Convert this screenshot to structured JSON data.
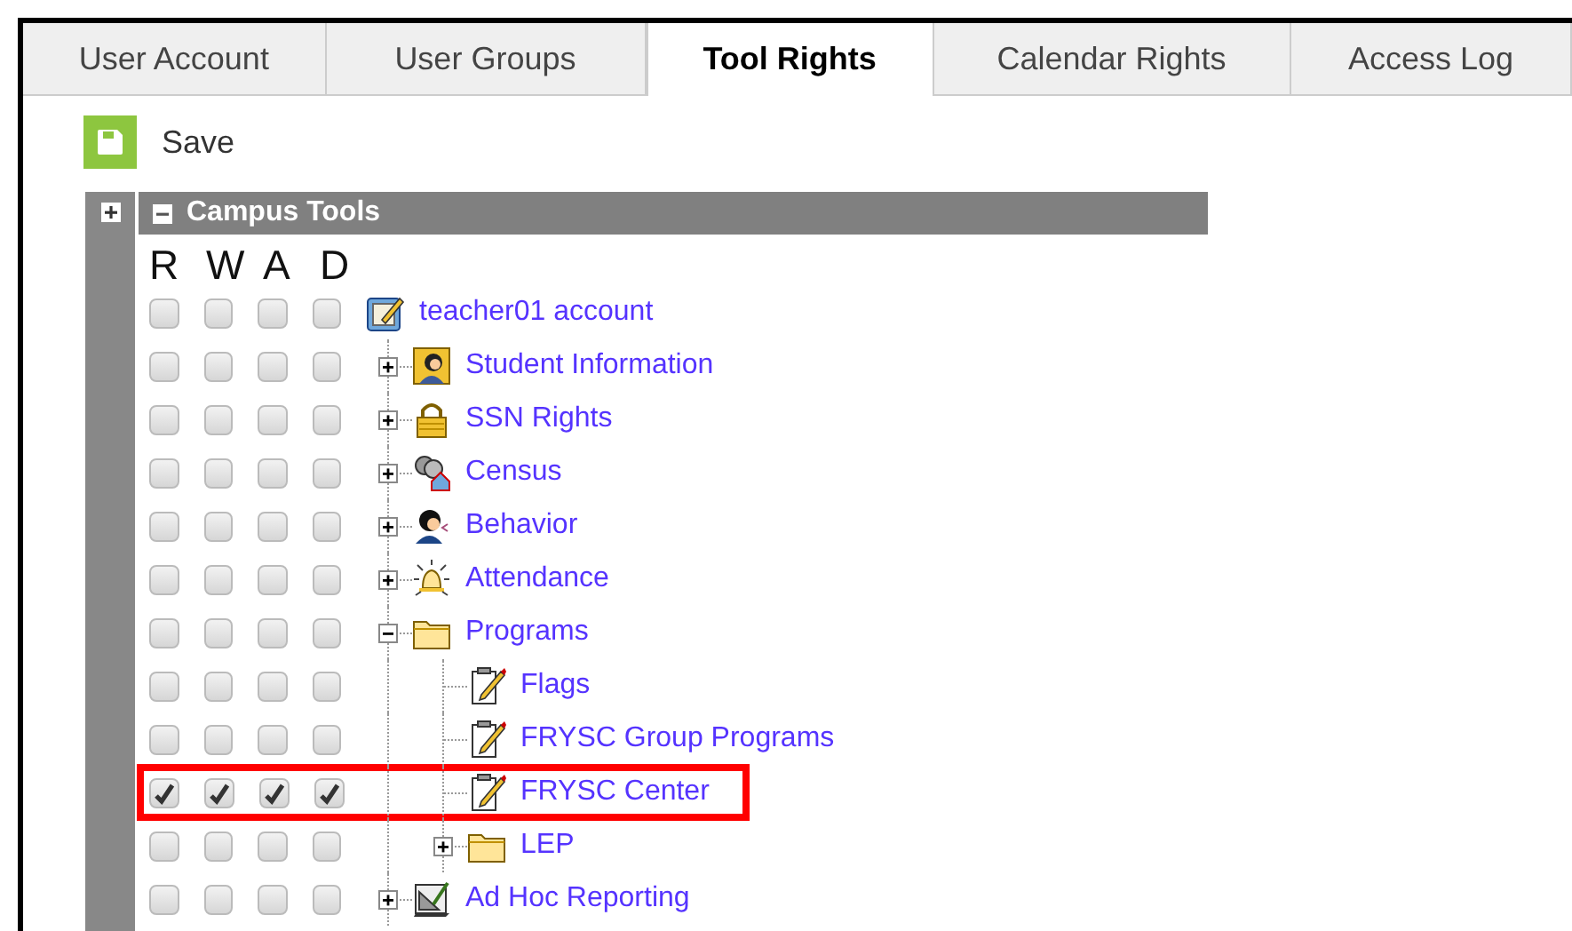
{
  "tabs": [
    {
      "label": "User Account",
      "selected": false
    },
    {
      "label": "User Groups",
      "selected": false
    },
    {
      "label": "Tool Rights",
      "selected": true
    },
    {
      "label": "Calendar Rights",
      "selected": false
    },
    {
      "label": "Access Log",
      "selected": false
    }
  ],
  "toolbar": {
    "save": "Save"
  },
  "panel": {
    "title": "Campus Tools",
    "expanded": true,
    "columns": [
      "R",
      "W",
      "A",
      "D"
    ]
  },
  "tree": {
    "label": "teacher01 account",
    "kind": "account",
    "rights": [
      false,
      false,
      false,
      false
    ],
    "highlighted": false,
    "children": [
      {
        "label": "Student Information",
        "kind": "student",
        "rights": [
          false,
          false,
          false,
          false
        ],
        "highlighted": false,
        "expanded": false
      },
      {
        "label": "SSN Rights",
        "kind": "lock",
        "rights": [
          false,
          false,
          false,
          false
        ],
        "highlighted": false,
        "expanded": false
      },
      {
        "label": "Census",
        "kind": "census",
        "rights": [
          false,
          false,
          false,
          false
        ],
        "highlighted": false,
        "expanded": false
      },
      {
        "label": "Behavior",
        "kind": "behavior",
        "rights": [
          false,
          false,
          false,
          false
        ],
        "highlighted": false,
        "expanded": false
      },
      {
        "label": "Attendance",
        "kind": "attendance",
        "rights": [
          false,
          false,
          false,
          false
        ],
        "highlighted": false,
        "expanded": false
      },
      {
        "label": "Programs",
        "kind": "folder",
        "rights": [
          false,
          false,
          false,
          false
        ],
        "highlighted": false,
        "expanded": true,
        "children": [
          {
            "label": "Flags",
            "kind": "tool",
            "rights": [
              false,
              false,
              false,
              false
            ],
            "highlighted": false
          },
          {
            "label": "FRYSC Group Programs",
            "kind": "tool",
            "rights": [
              false,
              false,
              false,
              false
            ],
            "highlighted": false
          },
          {
            "label": "FRYSC Center",
            "kind": "tool",
            "rights": [
              true,
              true,
              true,
              true
            ],
            "highlighted": true
          },
          {
            "label": "LEP",
            "kind": "folder",
            "rights": [
              false,
              false,
              false,
              false
            ],
            "highlighted": false,
            "expanded": false
          }
        ]
      },
      {
        "label": "Ad Hoc Reporting",
        "kind": "report",
        "rights": [
          false,
          false,
          false,
          false
        ],
        "highlighted": false,
        "expanded": false
      }
    ]
  }
}
